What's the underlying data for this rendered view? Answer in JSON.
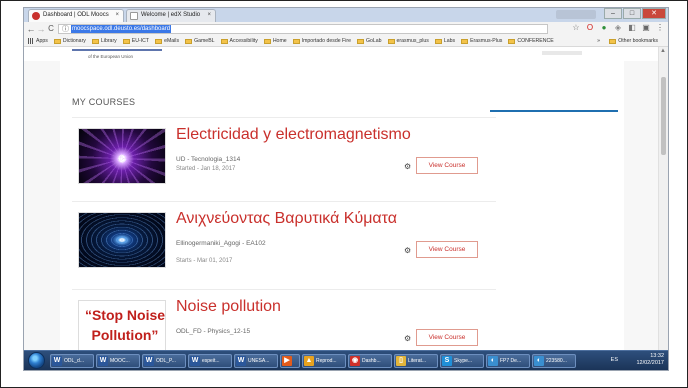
{
  "browser": {
    "tabs": [
      {
        "label": "Dashboard | ODL Moocs",
        "close": "×",
        "icon_color": "#c9302c"
      },
      {
        "label": "Welcome | edX Studio",
        "close": "×",
        "icon_color": "#777777"
      }
    ],
    "window_controls": {
      "minimize": "–",
      "maximize": "□",
      "close": "✕"
    },
    "nav": {
      "back": "←",
      "forward": "→",
      "reload": "C"
    },
    "address": {
      "info": "ⓘ",
      "url": "moocspace.odl.deusto.es/dashboard"
    },
    "toolbar_icons": [
      {
        "name": "star-icon",
        "glyph": "☆",
        "color": "#666666"
      },
      {
        "name": "opera-icon",
        "glyph": "O",
        "color": "#d2201c"
      },
      {
        "name": "chrome-ext-icon",
        "glyph": "●",
        "color": "#2f8f3a"
      },
      {
        "name": "shield-icon",
        "glyph": "◈",
        "color": "#888888"
      },
      {
        "name": "extension-icon",
        "glyph": "◧",
        "color": "#777777"
      },
      {
        "name": "cast-icon",
        "glyph": "▣",
        "color": "#666666"
      },
      {
        "name": "menu-icon",
        "glyph": "⋮",
        "color": "#555555"
      }
    ]
  },
  "bookmarks": {
    "apps": "Apps",
    "items": [
      "Dictionary",
      "Library",
      "EU-ICT",
      "eMails",
      "GameBL",
      "Accessibility",
      "Home",
      "Importado desde Fire",
      "GoLab",
      "erasmus_plus",
      "Labs",
      "Erasmus-Plus",
      "CONFERENCE"
    ],
    "more": "»",
    "other": "Other bookmarks"
  },
  "page": {
    "eu_text": "of the European Union",
    "section_title": "MY COURSES",
    "courses": [
      {
        "title": "Electricidad y electromagnetismo",
        "org": "UD - Tecnologia_1314",
        "date": "Started - Jan 18, 2017",
        "button": "View Course",
        "settings": "⚙"
      },
      {
        "title": "Ανιχνεύοντας Βαρυτικά Κύματα",
        "org": "Ellinogermaniki_Agogi - EA102",
        "date": "Starts - Mar 01, 2017",
        "button": "View Course",
        "settings": "⚙"
      },
      {
        "title": "Noise pollution",
        "org": "ODL_FD - Physics_12-15",
        "date": "",
        "button": "View Course",
        "settings": "⚙",
        "thumb_text": [
          "“Stop Noise",
          "Pollution”"
        ]
      }
    ]
  },
  "taskbar": {
    "items": [
      {
        "label": "ODL_d...",
        "icon": "W",
        "color": "#2b579a"
      },
      {
        "label": "MOOC...",
        "icon": "W",
        "color": "#2b579a"
      },
      {
        "label": "ODL_P...",
        "icon": "W",
        "color": "#2b579a"
      },
      {
        "label": "espeit...",
        "icon": "W",
        "color": "#2b579a"
      },
      {
        "label": "UNESA...",
        "icon": "W",
        "color": "#2b579a"
      },
      {
        "label": "",
        "icon": "▶",
        "color": "#e25b1b"
      },
      {
        "label": "Reprod...",
        "icon": "▲",
        "color": "#e7a21f"
      },
      {
        "label": "Dashb...",
        "icon": "◉",
        "color": "#d0302a"
      },
      {
        "label": "Literat...",
        "icon": "▯",
        "color": "#e2b53a"
      },
      {
        "label": "Skype...",
        "icon": "S",
        "color": "#1f8fd8"
      },
      {
        "label": "FP7 De...",
        "icon": "◐",
        "color": "#3a8fd0"
      },
      {
        "label": "223580...",
        "icon": "◐",
        "color": "#3a8fd0"
      }
    ],
    "lang": "ES",
    "time": "13:32",
    "date": "12/02/2017"
  }
}
